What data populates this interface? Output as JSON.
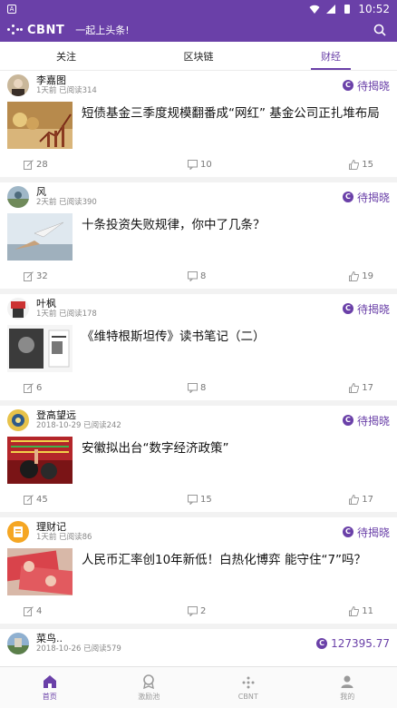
{
  "status_bar": {
    "time": "10:52"
  },
  "app_bar": {
    "logo_text": "CBNT",
    "slogan": "一起上头条!"
  },
  "tabs": [
    {
      "label": "关注"
    },
    {
      "label": "区块链"
    },
    {
      "label": "财经"
    }
  ],
  "active_tab": "财经",
  "posts": [
    {
      "author": "李嘉图",
      "sub": "1天前 已阅读314",
      "reward": "待揭晓",
      "title": "短债基金三季度规模翻番成“网红” 基金公司正扎堆布局",
      "comments": "28",
      "shares": "10",
      "likes": "15"
    },
    {
      "author": "风",
      "sub": "2天前 已阅读390",
      "reward": "待揭晓",
      "title": "十条投资失败规律，你中了几条？",
      "comments": "32",
      "shares": "8",
      "likes": "19"
    },
    {
      "author": "叶枫",
      "sub": "1天前 已阅读178",
      "reward": "待揭晓",
      "title": "《维特根斯坦传》读书笔记（二）",
      "comments": "6",
      "shares": "8",
      "likes": "17"
    },
    {
      "author": "登高望远",
      "sub": "2018-10-29 已阅读242",
      "reward": "待揭晓",
      "title": "安徽拟出台“数字经济政策”",
      "comments": "45",
      "shares": "15",
      "likes": "17"
    },
    {
      "author": "理财记",
      "sub": "1天前 已阅读86",
      "reward": "待揭晓",
      "title": "人民币汇率创10年新低！白热化博弈 能守住“7”吗？",
      "comments": "4",
      "shares": "2",
      "likes": "11"
    },
    {
      "author": "菜鸟..",
      "sub": "2018-10-26 已阅读579",
      "reward": "127395.77",
      "title": "",
      "comments": "",
      "shares": "",
      "likes": ""
    }
  ],
  "bottom_nav": [
    {
      "label": "首页",
      "icon": "home-icon"
    },
    {
      "label": "激励池",
      "icon": "medal-icon"
    },
    {
      "label": "CBNT",
      "icon": "cbnt-icon"
    },
    {
      "label": "我的",
      "icon": "user-icon"
    }
  ],
  "colors": {
    "accent": "#6a40a8"
  }
}
